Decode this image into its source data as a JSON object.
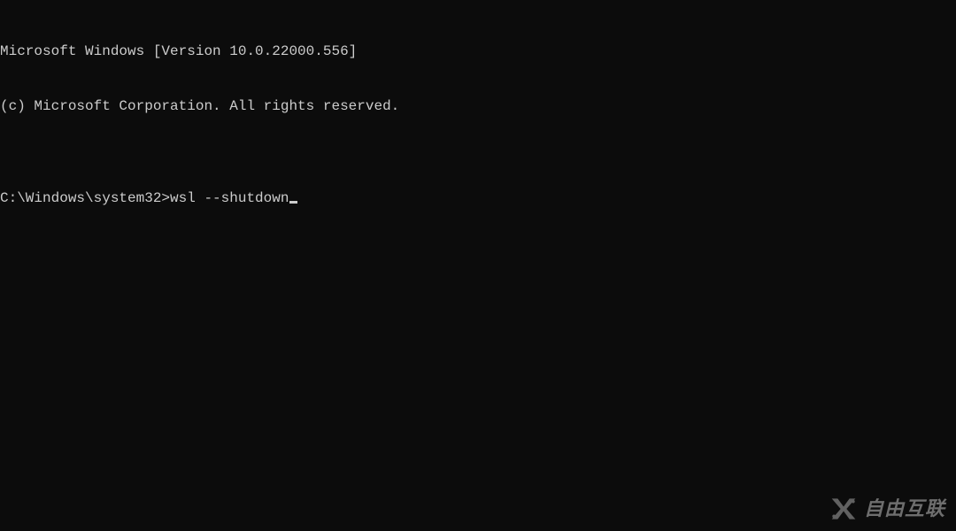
{
  "terminal": {
    "banner_line1": "Microsoft Windows [Version 10.0.22000.556]",
    "banner_line2": "(c) Microsoft Corporation. All rights reserved.",
    "blank": "",
    "prompt": "C:\\Windows\\system32>",
    "command": "wsl --shutdown"
  },
  "watermark": {
    "icon_name": "x-logo-icon",
    "text": "自由互联"
  }
}
